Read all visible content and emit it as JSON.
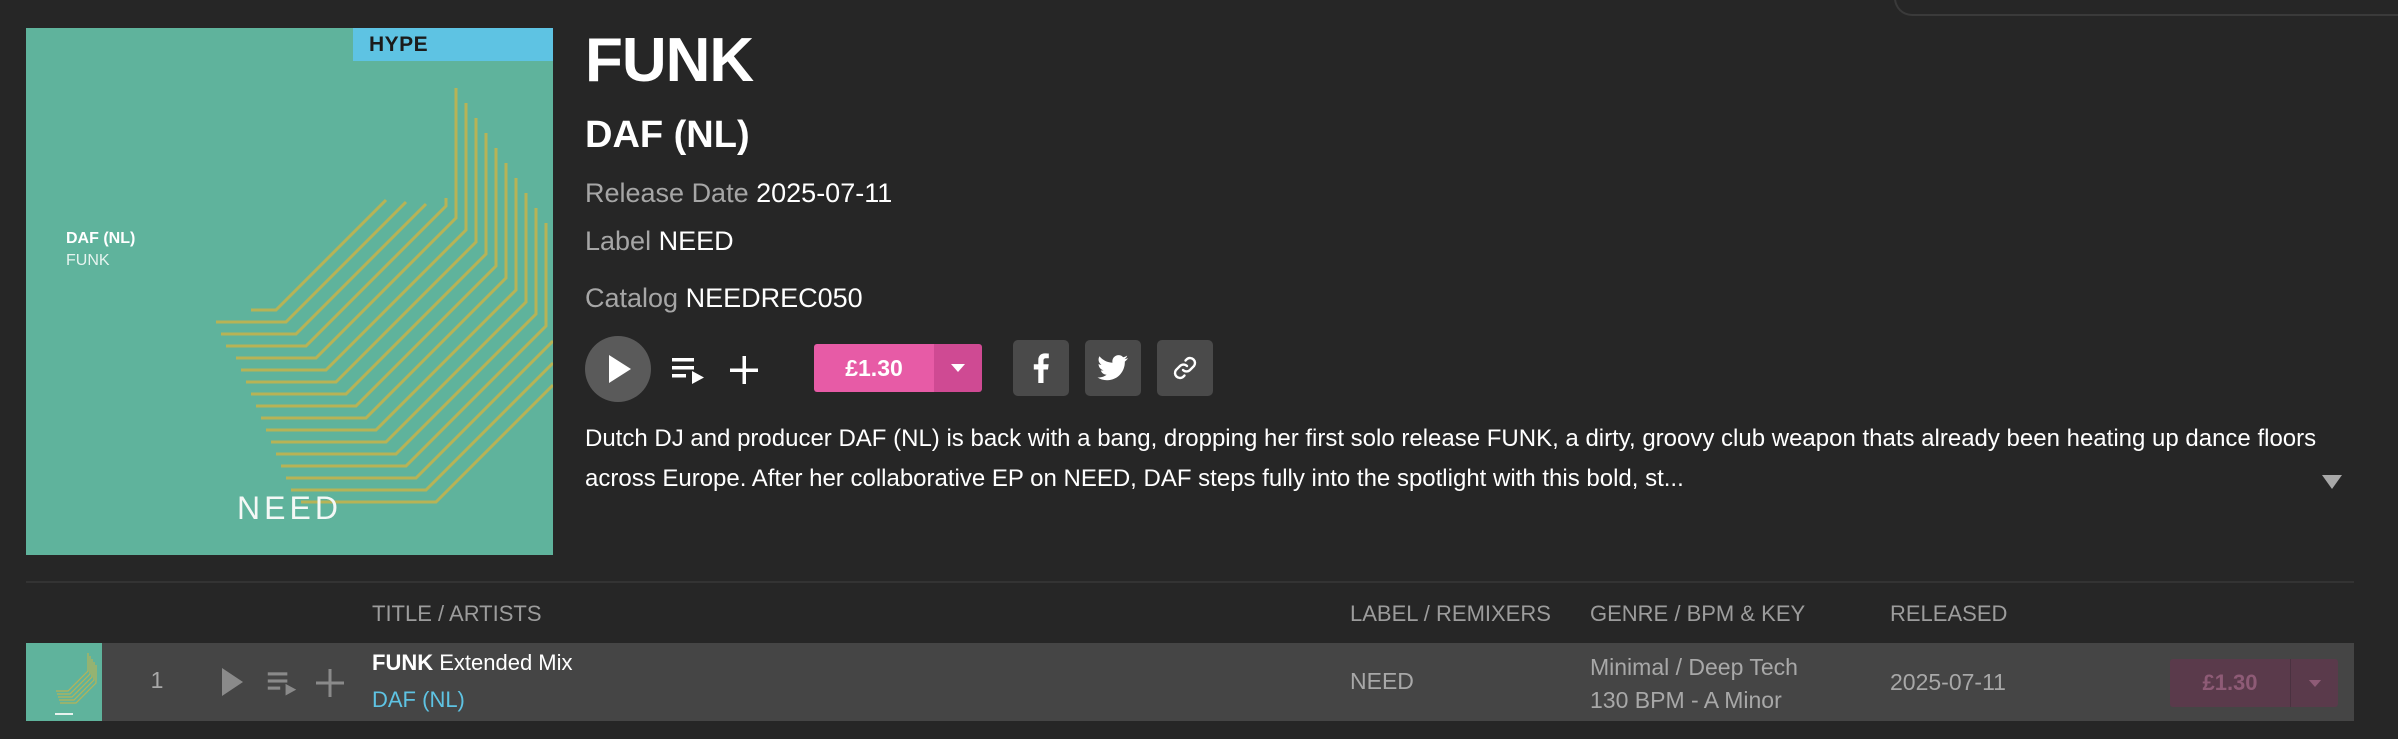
{
  "cover": {
    "badge": "HYPE",
    "artist": "DAF (NL)",
    "title": "FUNK",
    "label": "NEED",
    "colors": {
      "background": "#5fb39c",
      "lines": "#c7b34a",
      "badge": "#5ec3e3"
    }
  },
  "release": {
    "title": "FUNK",
    "artist": "DAF (NL)",
    "release_date_label": "Release Date",
    "release_date": "2025-07-11",
    "label_label": "Label",
    "label": "NEED",
    "catalog_label": "Catalog",
    "catalog": "NEEDREC050",
    "description": "Dutch DJ and producer DAF (NL) is back with a bang, dropping her first solo release FUNK, a dirty, groovy club weapon thats already been heating up dance floors across Europe. After her collaborative EP on NEED, DAF steps fully into the spotlight with this bold, st..."
  },
  "actions": {
    "price": "£1.30",
    "icons": [
      "play-icon",
      "add-to-queue-icon",
      "add-icon",
      "dropdown-caret-icon",
      "facebook-icon",
      "twitter-icon",
      "link-icon",
      "expand-arrow-icon"
    ]
  },
  "table": {
    "headers": {
      "title_artists": "TITLE / ARTISTS",
      "label_remixers": "LABEL / REMIXERS",
      "genre_bpm_key": "GENRE / BPM & KEY",
      "released": "RELEASED"
    },
    "rows": [
      {
        "number": "1",
        "title": "FUNK",
        "mix": "Extended Mix",
        "artist": "DAF (NL)",
        "label": "NEED",
        "genre": "Minimal / Deep Tech",
        "bpm_key": "130 BPM - A Minor",
        "released": "2025-07-11",
        "price": "£1.30"
      }
    ]
  },
  "colors": {
    "accent": "#e75ba6",
    "link": "#5ec3e3",
    "background": "#262626"
  }
}
